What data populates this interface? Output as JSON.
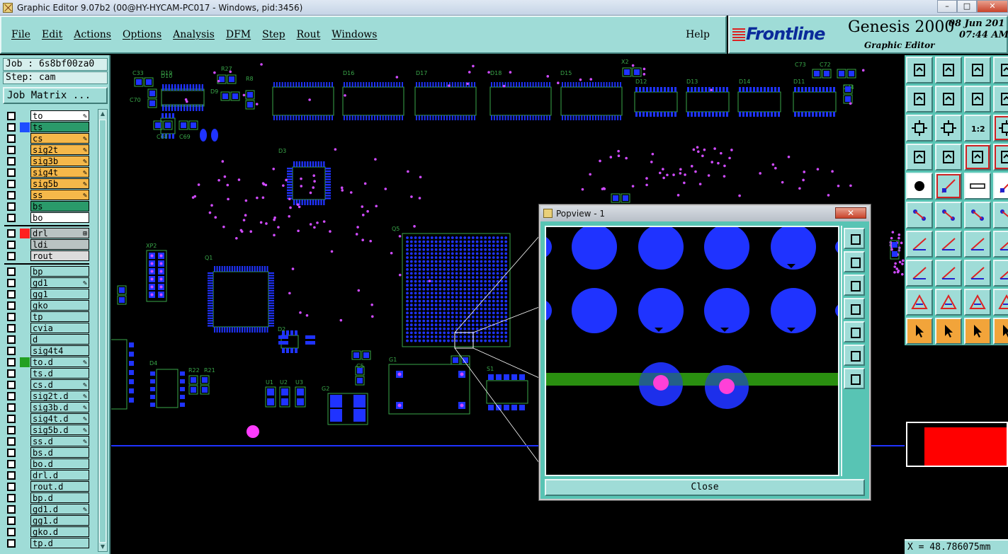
{
  "window": {
    "title": "Graphic Editor 9.07b2 (00@HY-HYCAM-PC017 - Windows, pid:3456)",
    "controls": [
      "–",
      "□",
      "✕"
    ]
  },
  "menu": {
    "items": [
      "File",
      "Edit",
      "Actions",
      "Options",
      "Analysis",
      "DFM",
      "Step",
      "Rout",
      "Windows"
    ],
    "help": "Help"
  },
  "brand": {
    "logo": "Frontline",
    "product": "Genesis 2000",
    "subtitle": "Graphic Editor",
    "date": "08 Jun 201",
    "time": "07:44 AM"
  },
  "job": {
    "job_label": "Job : 6s8bf00za0",
    "step_label": "Step: cam",
    "job_matrix_button": "Job Matrix ..."
  },
  "layers": {
    "group1": [
      {
        "name": "to",
        "color": "#ffffff",
        "mark": "✎",
        "swatch": ""
      },
      {
        "name": "ts",
        "color": "#2a9a6a",
        "mark": "",
        "swatch": "#1f4fff"
      },
      {
        "name": "cs",
        "color": "#f5b84a",
        "mark": "✎",
        "swatch": ""
      },
      {
        "name": "sig2t",
        "color": "#f5b84a",
        "mark": "✎",
        "swatch": ""
      },
      {
        "name": "sig3b",
        "color": "#f5b84a",
        "mark": "✎",
        "swatch": ""
      },
      {
        "name": "sig4t",
        "color": "#f5b84a",
        "mark": "✎",
        "swatch": ""
      },
      {
        "name": "sig5b",
        "color": "#f5b84a",
        "mark": "✎",
        "swatch": ""
      },
      {
        "name": "ss",
        "color": "#f5b84a",
        "mark": "✎",
        "swatch": ""
      },
      {
        "name": "bs",
        "color": "#2a9a6a",
        "mark": "",
        "swatch": ""
      },
      {
        "name": "bo",
        "color": "#ffffff",
        "mark": "",
        "swatch": ""
      }
    ],
    "group2": [
      {
        "name": "drl",
        "color": "#b9c3c3",
        "mark": "⊞",
        "swatch": "#ff2020"
      },
      {
        "name": "ldi",
        "color": "#b9c3c3",
        "mark": "",
        "swatch": ""
      },
      {
        "name": "rout",
        "color": "#dcdcdc",
        "mark": "",
        "swatch": ""
      }
    ],
    "group3": [
      {
        "name": "bp",
        "color": "#9fdcd7",
        "mark": "",
        "swatch": ""
      },
      {
        "name": "gd1",
        "color": "#9fdcd7",
        "mark": "✎",
        "swatch": ""
      },
      {
        "name": "gg1",
        "color": "#9fdcd7",
        "mark": "",
        "swatch": ""
      },
      {
        "name": "gko",
        "color": "#9fdcd7",
        "mark": "",
        "swatch": ""
      },
      {
        "name": "tp",
        "color": "#9fdcd7",
        "mark": "",
        "swatch": ""
      },
      {
        "name": "cvia",
        "color": "#9fdcd7",
        "mark": "",
        "swatch": ""
      },
      {
        "name": "d",
        "color": "#9fdcd7",
        "mark": "",
        "swatch": ""
      },
      {
        "name": "sig4t4",
        "color": "#9fdcd7",
        "mark": "",
        "swatch": ""
      },
      {
        "name": "to.d",
        "color": "#9fdcd7",
        "mark": "✎",
        "swatch": "#22a022"
      },
      {
        "name": "ts.d",
        "color": "#9fdcd7",
        "mark": "",
        "swatch": ""
      },
      {
        "name": "cs.d",
        "color": "#9fdcd7",
        "mark": "✎",
        "swatch": ""
      },
      {
        "name": "sig2t.d",
        "color": "#9fdcd7",
        "mark": "✎",
        "swatch": ""
      },
      {
        "name": "sig3b.d",
        "color": "#9fdcd7",
        "mark": "✎",
        "swatch": ""
      },
      {
        "name": "sig4t.d",
        "color": "#9fdcd7",
        "mark": "✎",
        "swatch": ""
      },
      {
        "name": "sig5b.d",
        "color": "#9fdcd7",
        "mark": "✎",
        "swatch": ""
      },
      {
        "name": "ss.d",
        "color": "#9fdcd7",
        "mark": "✎",
        "swatch": ""
      },
      {
        "name": "bs.d",
        "color": "#9fdcd7",
        "mark": "",
        "swatch": ""
      },
      {
        "name": "bo.d",
        "color": "#9fdcd7",
        "mark": "",
        "swatch": ""
      },
      {
        "name": "drl.d",
        "color": "#9fdcd7",
        "mark": "",
        "swatch": ""
      },
      {
        "name": "rout.d",
        "color": "#9fdcd7",
        "mark": "",
        "swatch": ""
      },
      {
        "name": "bp.d",
        "color": "#9fdcd7",
        "mark": "",
        "swatch": ""
      },
      {
        "name": "gd1.d",
        "color": "#9fdcd7",
        "mark": "✎",
        "swatch": ""
      },
      {
        "name": "gg1.d",
        "color": "#9fdcd7",
        "mark": "",
        "swatch": ""
      },
      {
        "name": "gko.d",
        "color": "#9fdcd7",
        "mark": "",
        "swatch": ""
      },
      {
        "name": "tp.d",
        "color": "#9fdcd7",
        "mark": "",
        "swatch": ""
      }
    ]
  },
  "board": {
    "refdes": [
      "C33",
      "D10",
      "R27",
      "R8",
      "D19",
      "D16",
      "D17",
      "D18",
      "D15",
      "X2",
      "D12",
      "D13",
      "D14",
      "D11",
      "C73",
      "C72",
      "C74",
      "C70",
      "D9",
      "C68",
      "C69",
      "D3",
      "Q5",
      "XP2",
      "Q1",
      "D2",
      "D4",
      "R22",
      "R21",
      "C5",
      "G1",
      "S1",
      "U1",
      "U2",
      "U3",
      "G2"
    ]
  },
  "popview": {
    "title": "Popview - 1",
    "close_label": "Close"
  },
  "tools": {
    "rows": 12
  },
  "status": {
    "coord": "X = 48.786075mm"
  },
  "colors": {
    "panel": "#9fdcd7",
    "pad": "#1f33ff",
    "outline": "#3aa84a",
    "via": "#d04bff",
    "trace": "#2a8f10"
  }
}
